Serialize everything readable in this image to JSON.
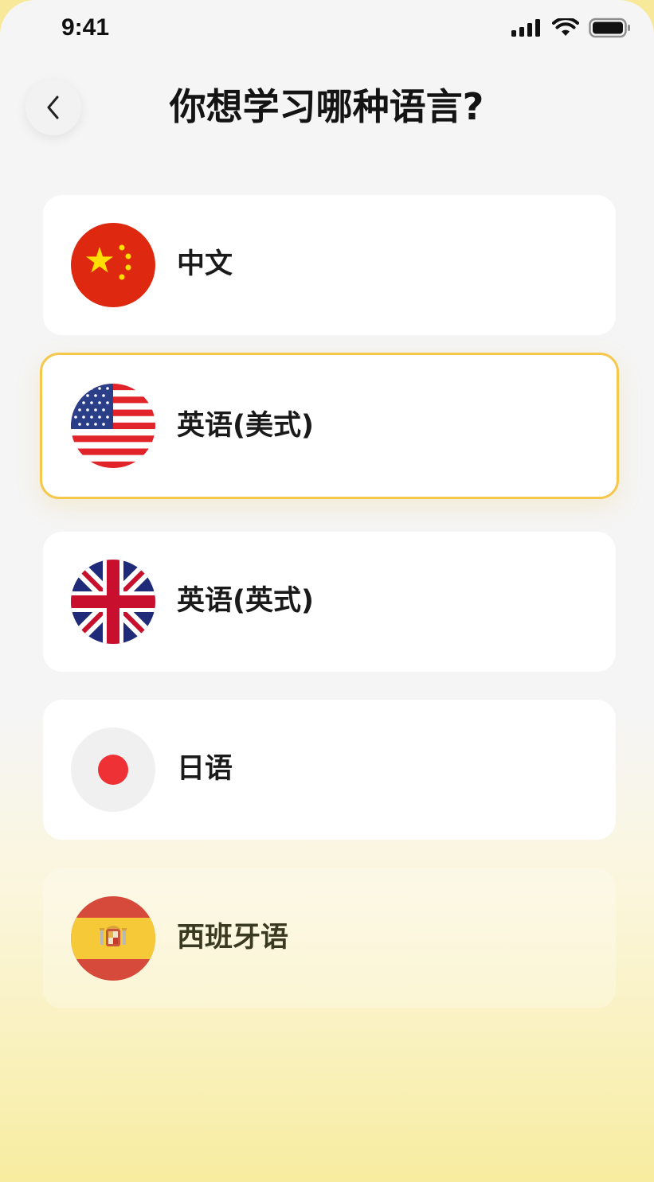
{
  "status_bar": {
    "time": "9:41",
    "icons": [
      "signal-icon",
      "wifi-icon",
      "battery-icon"
    ]
  },
  "header": {
    "back_icon": "chevron-left-icon",
    "title": "你想学习哪种语言?"
  },
  "languages": [
    {
      "label": "中文",
      "flag": "china-flag-icon",
      "selected": false
    },
    {
      "label": "英语(美式)",
      "flag": "usa-flag-icon",
      "selected": true
    },
    {
      "label": "英语(英式)",
      "flag": "uk-flag-icon",
      "selected": false
    },
    {
      "label": "日语",
      "flag": "japan-flag-icon",
      "selected": false
    },
    {
      "label": "西班牙语",
      "flag": "spain-flag-icon",
      "selected": false
    }
  ],
  "colors": {
    "selected_border": "#f5c84b",
    "background_top": "#f5f5f5",
    "background_bottom": "#f7ec9f"
  }
}
